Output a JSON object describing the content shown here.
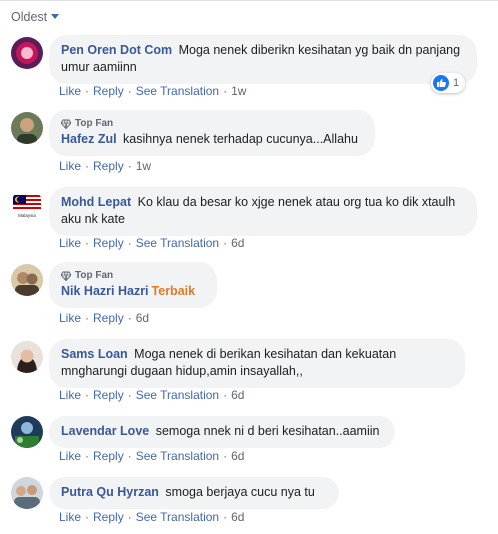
{
  "sort": {
    "label": "Oldest"
  },
  "actions": {
    "like": "Like",
    "reply": "Reply",
    "see_translation": "See Translation",
    "sep": "·"
  },
  "badge": {
    "top_fan": "Top Fan"
  },
  "comments": [
    {
      "author": "Pen Oren Dot Com",
      "text": "Moga nenek diberikn kesihatan yg baik dn panjang umur aamiinn",
      "time": "1w",
      "reaction_count": "1"
    },
    {
      "author": "Hafez Zul",
      "text": "kasihnya nenek terhadap cucunya...Allahu",
      "time": "1w"
    },
    {
      "author": "Mohd Lepat",
      "text": "Ko klau da besar ko xjge nenek atau org tua ko dik xtaulh aku nk kate",
      "time": "6d",
      "avatar_text": "Malaysia"
    },
    {
      "author": "Nik Hazri Hazri",
      "text": "Terbaik",
      "time": "6d"
    },
    {
      "author": "Sams Loan",
      "text": "Moga nenek di berikan kesihatan dan kekuatan mngharungi dugaan hidup,amin insayallah,,",
      "time": "6d"
    },
    {
      "author": "Lavendar Love",
      "text": "semoga nnek ni d beri kesihatan..aamiin",
      "time": "6d"
    },
    {
      "author": "Putra Qu Hyrzan",
      "text": "smoga berjaya cucu nya tu",
      "time": "6d"
    }
  ],
  "colors": {
    "link": "#385898",
    "action": "#4267b2",
    "bubble": "#f2f3f5",
    "meta": "#606770",
    "highlight": "#e07b24"
  }
}
